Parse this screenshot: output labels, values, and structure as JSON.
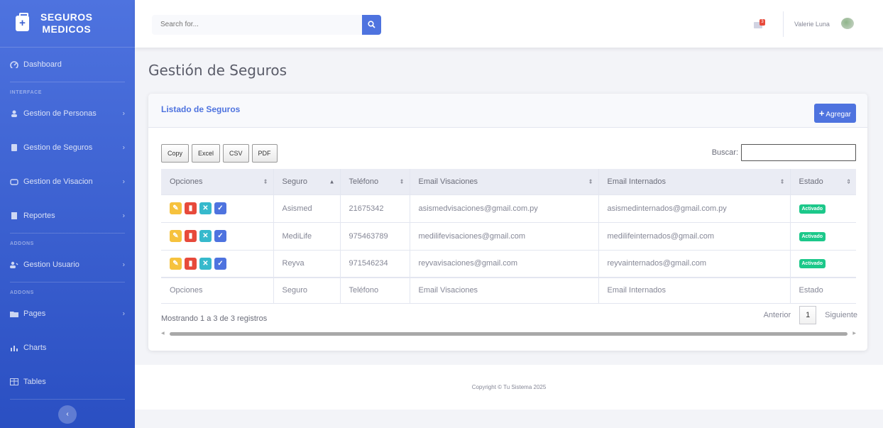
{
  "brand": {
    "line1": "SEGUROS",
    "line2": "MEDICOS"
  },
  "sidebar": {
    "dashboard": "Dashboard",
    "heading_interface": "INTERFACE",
    "items_interface": [
      {
        "label": "Gestion de Personas",
        "icon": "user-icon"
      },
      {
        "label": "Gestion de Seguros",
        "icon": "folder-icon"
      },
      {
        "label": "Gestion de Visacion",
        "icon": "cloud-icon"
      },
      {
        "label": "Reportes",
        "icon": "report-icon"
      }
    ],
    "heading_addons1": "ADDONS",
    "gestion_usuario": "Gestion Usuario",
    "heading_addons2": "ADDONS",
    "pages": "Pages",
    "charts": "Charts",
    "tables": "Tables"
  },
  "topbar": {
    "search_placeholder": "Search for...",
    "alert_count": "3",
    "user_name": "Valerie Luna"
  },
  "main": {
    "page_title": "Gestión de Seguros",
    "card_title": "Listado de Seguros",
    "add_label": "Agregar",
    "export_buttons": [
      "Copy",
      "Excel",
      "CSV",
      "PDF"
    ],
    "filter_label": "Buscar:",
    "columns": [
      "Opciones",
      "Seguro",
      "Teléfono",
      "Email Visaciones",
      "Email Internados",
      "Estado"
    ],
    "rows": [
      {
        "seguro": "Asismed",
        "telefono": "21675342",
        "email_vis": "asismedvisaciones@gmail.com.py",
        "email_int": "asismedinternados@gmail.com.py",
        "estado": "Activado"
      },
      {
        "seguro": "MediLife",
        "telefono": "975463789",
        "email_vis": "medilifevisaciones@gmail.com",
        "email_int": "medilifeinternados@gmail.com",
        "estado": "Activado"
      },
      {
        "seguro": "Reyva",
        "telefono": "971546234",
        "email_vis": "reyvavisaciones@gmail.com",
        "email_int": "reyvainternados@gmail.com",
        "estado": "Activado"
      }
    ],
    "info": "Mostrando 1 a 3 de 3 registros",
    "pager": {
      "prev": "Anterior",
      "current": "1",
      "next": "Siguiente"
    }
  },
  "footer": {
    "copyright": "Copyright © Tu Sistema 2025"
  },
  "colors": {
    "primary": "#4e73df",
    "warning": "#f6c23e",
    "danger": "#e74a3b",
    "info": "#36b9cc",
    "success": "#1cc88a"
  }
}
